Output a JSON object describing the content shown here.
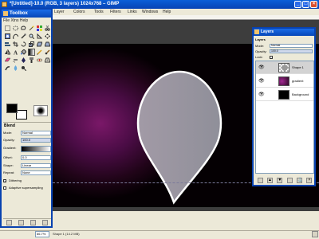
{
  "image_window": {
    "title": "*[Untitled]-10.0 (RGB, 3 layers) 1024x768 – GIMP",
    "menu": [
      "Layer",
      "Colors",
      "Tools",
      "Filters",
      "Links",
      "Windows",
      "Help"
    ],
    "zoom": "66.7%",
    "status": "Shape 1 (14.2 MB)"
  },
  "toolbox": {
    "title": "Toolbox",
    "menu": "File  Xtns  Help",
    "tools": [
      "rect-select-icon",
      "ellipse-select-icon",
      "lasso-icon",
      "fuzzy-select-icon",
      "color-select-icon",
      "scissors-icon",
      "foreground-select-icon",
      "paths-icon",
      "color-picker-icon",
      "zoom-icon",
      "measure-icon",
      "move-icon",
      "align-icon",
      "crop-icon",
      "rotate-icon",
      "scale-icon",
      "shear-icon",
      "perspective-icon",
      "flip-icon",
      "text-icon",
      "bucket-fill-icon",
      "blend-icon",
      "pencil-icon",
      "paintbrush-icon",
      "eraser-icon",
      "airbrush-icon",
      "ink-icon",
      "clone-icon",
      "heal-icon",
      "perspective-clone-icon",
      "smudge-icon",
      "blur-icon",
      "dodge-burn-icon"
    ],
    "options": {
      "title": "Blend",
      "mode_label": "Mode:",
      "mode_value": "Normal",
      "opacity_label": "Opacity:",
      "opacity_value": "100.0",
      "gradient_label": "Gradient:",
      "offset_label": "Offset:",
      "offset_value": "0.0",
      "shape_label": "Shape:",
      "shape_value": "Linear",
      "repeat_label": "Repeat:",
      "repeat_value": "None",
      "dithering_label": "Dithering",
      "adaptive_label": "Adaptive supersampling"
    }
  },
  "layers": {
    "title": "Layers",
    "header": "Layers",
    "mode_label": "Mode:",
    "mode_value": "Normal",
    "opacity_label": "Opacity:",
    "opacity_value": "100.0",
    "lock_label": "Lock:",
    "items": [
      {
        "name": "Shape 1",
        "selected": true
      },
      {
        "name": "gradient",
        "selected": false
      },
      {
        "name": "Background",
        "selected": false
      }
    ]
  },
  "colors": {
    "title_bar": "#0747b8",
    "canvas_center": "#7a1868",
    "pin_top": "#9a9aa6",
    "pin_bottom": "#c8c8d0"
  }
}
